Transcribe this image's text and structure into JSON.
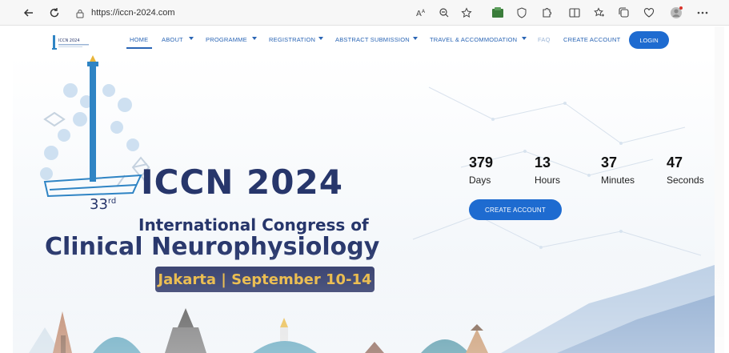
{
  "browser": {
    "url": "https://iccn-2024.com",
    "icons": [
      "back-icon",
      "refresh-icon",
      "lock-icon",
      "read-aloud-icon",
      "zoom-icon",
      "favorite-icon",
      "extension-icon",
      "shield-icon",
      "puzzle-icon",
      "split-screen-icon",
      "favorites-icon",
      "collections-icon",
      "heart-icon",
      "profile-icon",
      "more-icon"
    ]
  },
  "nav": {
    "logo_text": "ICCN 2024",
    "items": [
      "HOME",
      "ABOUT",
      "PROGRAMME",
      "REGISTRATION",
      "ABSTRACT SUBMISSION",
      "TRAVEL & ACCOMMODATION",
      "FAQ",
      "CREATE ACCOUNT"
    ],
    "login_label": "LOGIN"
  },
  "hero": {
    "title": "ICCN 2024",
    "edition_number": "33",
    "edition_suffix": "rd",
    "subtitle_line1": "International Congress of",
    "subtitle_line2": "Clinical Neurophysiology",
    "date_text": "Jakarta | September 10-14"
  },
  "countdown": [
    {
      "value": "379",
      "label": "Days"
    },
    {
      "value": "13",
      "label": "Hours"
    },
    {
      "value": "37",
      "label": "Minutes"
    },
    {
      "value": "47",
      "label": "Seconds"
    }
  ],
  "cta": {
    "create_account_label": "CREATE ACCOUNT"
  },
  "colors": {
    "brand_navy": "#27366b",
    "accent_blue": "#1e6bd0",
    "date_gold": "#e8b53a"
  }
}
